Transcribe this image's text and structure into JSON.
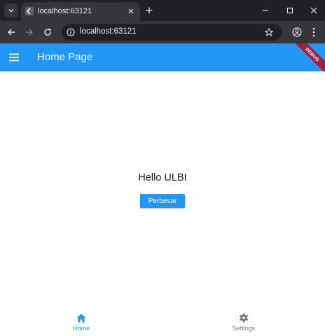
{
  "browser": {
    "tab_title": "localhost:63121",
    "url": "localhost:63121",
    "icons": [
      "tab-search-icon",
      "favicon-icon",
      "close-icon",
      "plus-icon",
      "minimize-icon",
      "maximize-icon",
      "close-window-icon",
      "back-arrow-icon",
      "forward-arrow-icon",
      "reload-icon",
      "site-info-icon",
      "star-icon",
      "profile-icon",
      "kebab-menu-icon"
    ]
  },
  "app": {
    "title": "Home Page",
    "debug_banner": "DEBUG",
    "primary_color": "#2196f3",
    "greeting": "Hello ULBI",
    "button_label": "Perbesar"
  },
  "bottom_nav": {
    "items": [
      {
        "label": "Home",
        "icon": "home-icon",
        "selected": true,
        "color": "#2196f3"
      },
      {
        "label": "Settings",
        "icon": "gear-icon",
        "selected": false,
        "color": "#757575"
      }
    ]
  }
}
